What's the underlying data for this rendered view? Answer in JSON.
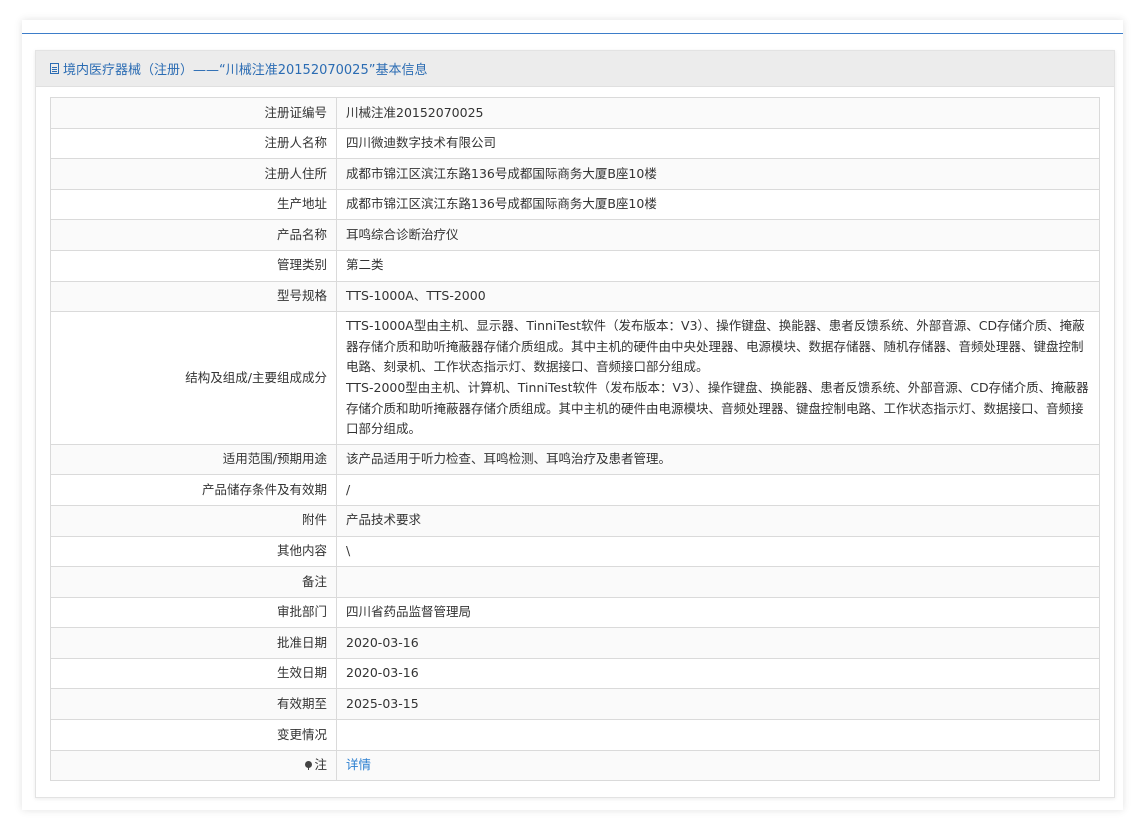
{
  "header": {
    "title": "境内医疗器械（注册）——“川械注准20152070025”基本信息",
    "icon": "document-icon"
  },
  "rows": [
    {
      "label": "注册证编号",
      "value": "川械注准20152070025"
    },
    {
      "label": "注册人名称",
      "value": "四川微迪数字技术有限公司"
    },
    {
      "label": "注册人住所",
      "value": "成都市锦江区滨江东路136号成都国际商务大厦B座10楼"
    },
    {
      "label": "生产地址",
      "value": "成都市锦江区滨江东路136号成都国际商务大厦B座10楼"
    },
    {
      "label": "产品名称",
      "value": "耳鸣综合诊断治疗仪"
    },
    {
      "label": "管理类别",
      "value": "第二类"
    },
    {
      "label": "型号规格",
      "value": "TTS-1000A、TTS-2000"
    },
    {
      "label": "结构及组成/主要组成成分",
      "value": "TTS-1000A型由主机、显示器、TinniTest软件（发布版本：V3）、操作键盘、换能器、患者反馈系统、外部音源、CD存储介质、掩蔽器存储介质和助听掩蔽器存储介质组成。其中主机的硬件由中央处理器、电源模块、数据存储器、随机存储器、音频处理器、键盘控制电路、刻录机、工作状态指示灯、数据接口、音频接口部分组成。\nTTS-2000型由主机、计算机、TinniTest软件（发布版本：V3）、操作键盘、换能器、患者反馈系统、外部音源、CD存储介质、掩蔽器存储介质和助听掩蔽器存储介质组成。其中主机的硬件由电源模块、音频处理器、键盘控制电路、工作状态指示灯、数据接口、音频接口部分组成。"
    },
    {
      "label": "适用范围/预期用途",
      "value": "该产品适用于听力检查、耳鸣检测、耳鸣治疗及患者管理。"
    },
    {
      "label": "产品储存条件及有效期",
      "value": "/"
    },
    {
      "label": "附件",
      "value": "产品技术要求"
    },
    {
      "label": "其他内容",
      "value": "\\"
    },
    {
      "label": "备注",
      "value": ""
    },
    {
      "label": "审批部门",
      "value": "四川省药品监督管理局"
    },
    {
      "label": "批准日期",
      "value": "2020-03-16"
    },
    {
      "label": "生效日期",
      "value": "2020-03-16"
    },
    {
      "label": "有效期至",
      "value": "2025-03-15"
    },
    {
      "label": "变更情况",
      "value": ""
    },
    {
      "label": "注",
      "value": "详情",
      "icon": "pin-icon"
    }
  ],
  "colors": {
    "accent": "#2b6cb3",
    "link": "#2b7fd0",
    "header_bg": "#ececec"
  }
}
